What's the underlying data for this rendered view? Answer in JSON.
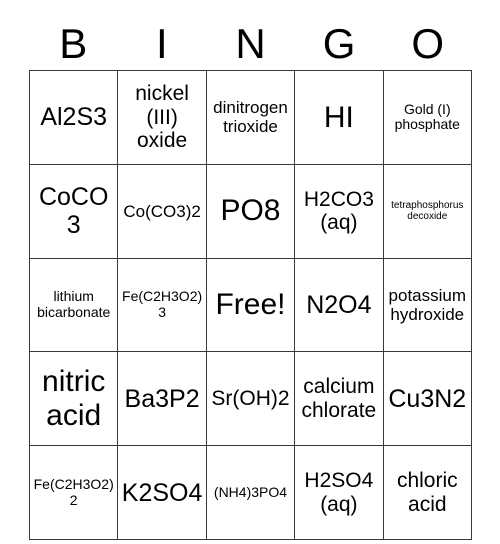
{
  "header": {
    "letters": [
      "B",
      "I",
      "N",
      "G",
      "O"
    ]
  },
  "grid": {
    "rows": [
      [
        {
          "text": "Al2S3",
          "size": "fs-lg"
        },
        {
          "text": "nickel (III) oxide",
          "size": "fs-md"
        },
        {
          "text": "dinitrogen trioxide",
          "size": "fs-sm"
        },
        {
          "text": "HI",
          "size": "fs-xl"
        },
        {
          "text": "Gold (I) phosphate",
          "size": "fs-xs"
        }
      ],
      [
        {
          "text": "CoCO3",
          "size": "fs-lg"
        },
        {
          "text": "Co(CO3)2",
          "size": "fs-sm"
        },
        {
          "text": "PO8",
          "size": "fs-xl"
        },
        {
          "text": "H2CO3 (aq)",
          "size": "fs-md"
        },
        {
          "text": "tetraphosphorus decoxide",
          "size": "fs-xxs"
        }
      ],
      [
        {
          "text": "lithium bicarbonate",
          "size": "fs-xs"
        },
        {
          "text": "Fe(C2H3O2)3",
          "size": "fs-xs"
        },
        {
          "text": "Free!",
          "size": "fs-xl"
        },
        {
          "text": "N2O4",
          "size": "fs-lg"
        },
        {
          "text": "potassium hydroxide",
          "size": "fs-sm"
        }
      ],
      [
        {
          "text": "nitric acid",
          "size": "fs-xl"
        },
        {
          "text": "Ba3P2",
          "size": "fs-lg"
        },
        {
          "text": "Sr(OH)2",
          "size": "fs-md"
        },
        {
          "text": "calcium chlorate",
          "size": "fs-md"
        },
        {
          "text": "Cu3N2",
          "size": "fs-lg"
        }
      ],
      [
        {
          "text": "Fe(C2H3O2)2",
          "size": "fs-xs"
        },
        {
          "text": "K2SO4",
          "size": "fs-lg"
        },
        {
          "text": "(NH4)3PO4",
          "size": "fs-xs"
        },
        {
          "text": "H2SO4 (aq)",
          "size": "fs-md"
        },
        {
          "text": "chloric acid",
          "size": "fs-md"
        }
      ]
    ]
  }
}
